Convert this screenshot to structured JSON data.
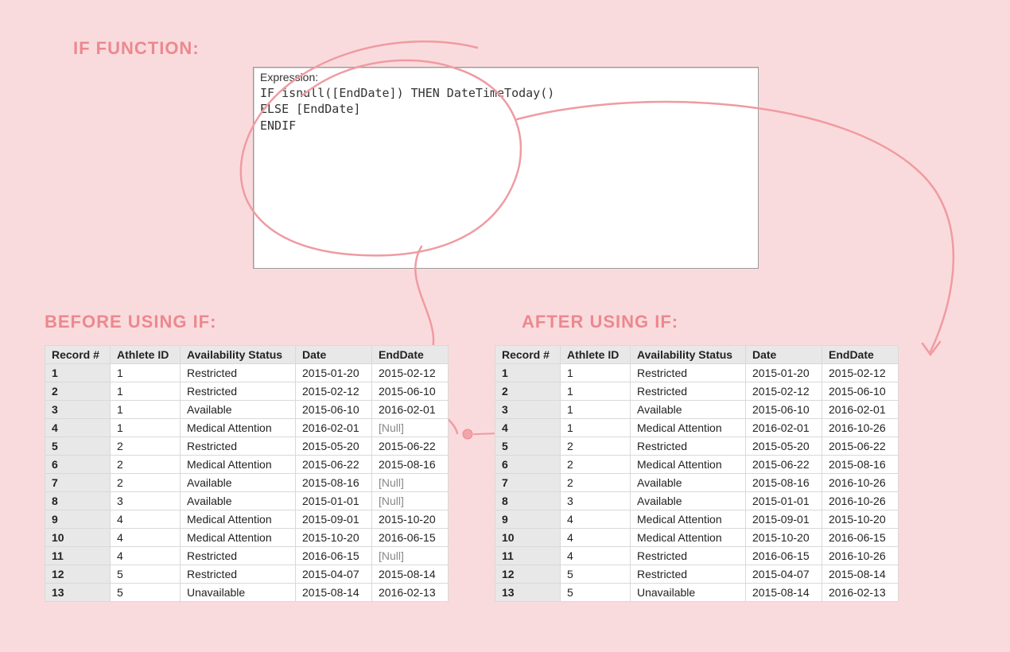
{
  "headings": {
    "if_function": "IF FUNCTION:",
    "before": "BEFORE USING IF:",
    "after": "AFTER USING IF:"
  },
  "expression": {
    "label": "Expression:",
    "line1": "IF isnull([EndDate]) THEN DateTimeToday()",
    "line2": "ELSE [EndDate]",
    "line3": "ENDIF"
  },
  "columns": {
    "record": "Record #",
    "athlete": "Athlete ID",
    "status": "Availability Status",
    "date": "Date",
    "enddate": "EndDate"
  },
  "null_text": "[Null]",
  "before_rows": [
    {
      "rec": "1",
      "ath": "1",
      "status": "Restricted",
      "date": "2015-01-20",
      "end": "2015-02-12"
    },
    {
      "rec": "2",
      "ath": "1",
      "status": "Restricted",
      "date": "2015-02-12",
      "end": "2015-06-10"
    },
    {
      "rec": "3",
      "ath": "1",
      "status": "Available",
      "date": "2015-06-10",
      "end": "2016-02-01"
    },
    {
      "rec": "4",
      "ath": "1",
      "status": "Medical Attention",
      "date": "2016-02-01",
      "end": null
    },
    {
      "rec": "5",
      "ath": "2",
      "status": "Restricted",
      "date": "2015-05-20",
      "end": "2015-06-22"
    },
    {
      "rec": "6",
      "ath": "2",
      "status": "Medical Attention",
      "date": "2015-06-22",
      "end": "2015-08-16"
    },
    {
      "rec": "7",
      "ath": "2",
      "status": "Available",
      "date": "2015-08-16",
      "end": null
    },
    {
      "rec": "8",
      "ath": "3",
      "status": "Available",
      "date": "2015-01-01",
      "end": null
    },
    {
      "rec": "9",
      "ath": "4",
      "status": "Medical Attention",
      "date": "2015-09-01",
      "end": "2015-10-20"
    },
    {
      "rec": "10",
      "ath": "4",
      "status": "Medical Attention",
      "date": "2015-10-20",
      "end": "2016-06-15"
    },
    {
      "rec": "11",
      "ath": "4",
      "status": "Restricted",
      "date": "2016-06-15",
      "end": null
    },
    {
      "rec": "12",
      "ath": "5",
      "status": "Restricted",
      "date": "2015-04-07",
      "end": "2015-08-14"
    },
    {
      "rec": "13",
      "ath": "5",
      "status": "Unavailable",
      "date": "2015-08-14",
      "end": "2016-02-13"
    }
  ],
  "after_rows": [
    {
      "rec": "1",
      "ath": "1",
      "status": "Restricted",
      "date": "2015-01-20",
      "end": "2015-02-12"
    },
    {
      "rec": "2",
      "ath": "1",
      "status": "Restricted",
      "date": "2015-02-12",
      "end": "2015-06-10"
    },
    {
      "rec": "3",
      "ath": "1",
      "status": "Available",
      "date": "2015-06-10",
      "end": "2016-02-01"
    },
    {
      "rec": "4",
      "ath": "1",
      "status": "Medical Attention",
      "date": "2016-02-01",
      "end": "2016-10-26"
    },
    {
      "rec": "5",
      "ath": "2",
      "status": "Restricted",
      "date": "2015-05-20",
      "end": "2015-06-22"
    },
    {
      "rec": "6",
      "ath": "2",
      "status": "Medical Attention",
      "date": "2015-06-22",
      "end": "2015-08-16"
    },
    {
      "rec": "7",
      "ath": "2",
      "status": "Available",
      "date": "2015-08-16",
      "end": "2016-10-26"
    },
    {
      "rec": "8",
      "ath": "3",
      "status": "Available",
      "date": "2015-01-01",
      "end": "2016-10-26"
    },
    {
      "rec": "9",
      "ath": "4",
      "status": "Medical Attention",
      "date": "2015-09-01",
      "end": "2015-10-20"
    },
    {
      "rec": "10",
      "ath": "4",
      "status": "Medical Attention",
      "date": "2015-10-20",
      "end": "2016-06-15"
    },
    {
      "rec": "11",
      "ath": "4",
      "status": "Restricted",
      "date": "2016-06-15",
      "end": "2016-10-26"
    },
    {
      "rec": "12",
      "ath": "5",
      "status": "Restricted",
      "date": "2015-04-07",
      "end": "2015-08-14"
    },
    {
      "rec": "13",
      "ath": "5",
      "status": "Unavailable",
      "date": "2015-08-14",
      "end": "2016-02-13"
    }
  ]
}
